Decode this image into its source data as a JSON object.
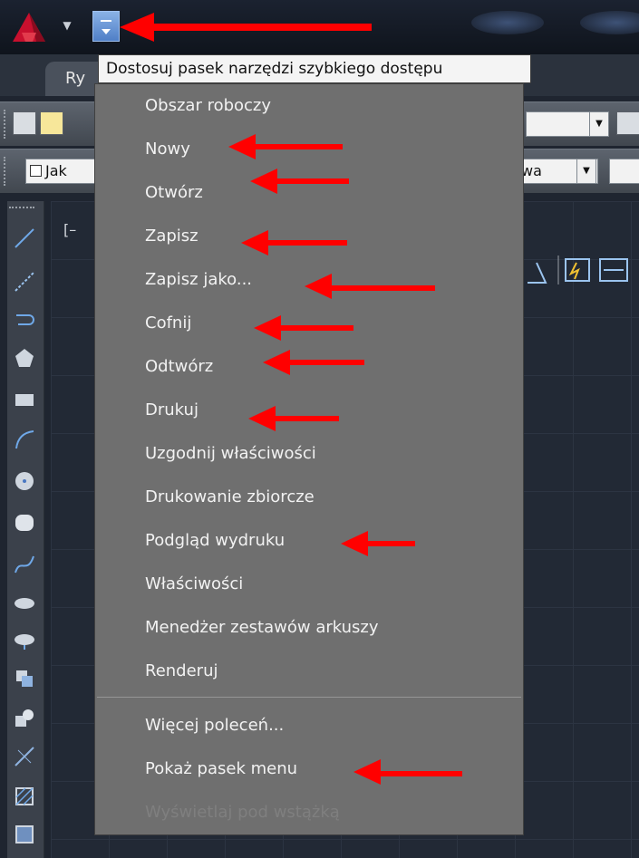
{
  "app": {
    "logo_icon": "autocad-logo-icon",
    "tab_label": "Ry",
    "accent_color": "#5584cc"
  },
  "toolbar": {
    "row2_field_label": "Jak",
    "row2_field2_text": "wa"
  },
  "viewport": {
    "label": "[–"
  },
  "menu": {
    "title": "Dostosuj pasek narzędzi szybkiego dostępu",
    "items": [
      {
        "label": "Obszar roboczy"
      },
      {
        "label": "Nowy"
      },
      {
        "label": "Otwórz"
      },
      {
        "label": "Zapisz"
      },
      {
        "label": "Zapisz jako..."
      },
      {
        "label": "Cofnij"
      },
      {
        "label": "Odtwórz"
      },
      {
        "label": "Drukuj"
      },
      {
        "label": "Uzgodnij właściwości"
      },
      {
        "label": "Drukowanie zbiorcze"
      },
      {
        "label": "Podgląd wydruku"
      },
      {
        "label": "Właściwości"
      },
      {
        "label": "Menedżer zestawów arkuszy"
      },
      {
        "label": "Renderuj"
      }
    ],
    "more_items": [
      {
        "label": "Więcej poleceń..."
      },
      {
        "label": "Pokaż pasek menu"
      },
      {
        "label": "Wyświetlaj pod wstążką"
      }
    ]
  },
  "annotation": {
    "arrow_color": "#ff0000"
  }
}
